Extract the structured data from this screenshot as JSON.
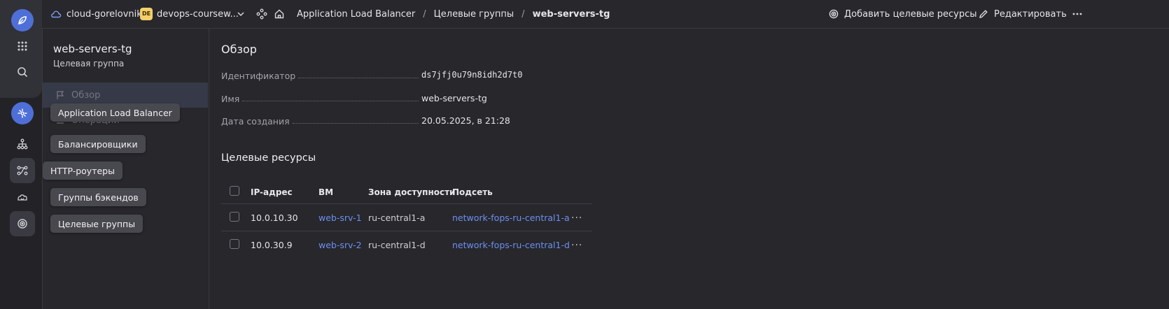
{
  "colors": {
    "accent": "#4f6fd8",
    "link": "#6e8ff0",
    "folder_badge": "#f4cf6a",
    "background": "#27272c"
  },
  "rail": {
    "icons": [
      "logo-icon",
      "apps-grid-icon",
      "search-icon",
      "alb-service-icon",
      "balancers-icon",
      "http-routers-icon",
      "backend-groups-icon",
      "target-groups-icon"
    ]
  },
  "topbar": {
    "cloud": "cloud-gorelovniko",
    "folder_badge": "DE",
    "folder": "devops-coursew...",
    "breadcrumbs": [
      "Application Load Balancer",
      "Целевые группы",
      "web-servers-tg"
    ],
    "add_resources": "Добавить целевые ресурсы",
    "edit": "Редактировать"
  },
  "sidebar": {
    "title": "web-servers-tg",
    "subtitle": "Целевая группа",
    "items": [
      {
        "label": "Обзор"
      },
      {
        "label": "Операции"
      }
    ]
  },
  "tooltips": [
    "Application Load Balancer",
    "Балансировщики",
    "HTTP-роутеры",
    "Группы бэкендов",
    "Целевые группы"
  ],
  "overview": {
    "title": "Обзор",
    "props": [
      {
        "label": "Идентификатор",
        "value": "ds7jfj0u79n8idh2d7t0"
      },
      {
        "label": "Имя",
        "value": "web-servers-tg"
      },
      {
        "label": "Дата создания",
        "value": "20.05.2025, в 21:28"
      }
    ]
  },
  "targets": {
    "title": "Целевые ресурсы",
    "columns": [
      "IP-адрес",
      "ВМ",
      "Зона доступности",
      "Подсеть"
    ],
    "rows": [
      {
        "ip": "10.0.10.30",
        "vm": "web-srv-1",
        "zone": "ru-central1-a",
        "subnet": "network-fops-ru-central1-a"
      },
      {
        "ip": "10.0.30.9",
        "vm": "web-srv-2",
        "zone": "ru-central1-d",
        "subnet": "network-fops-ru-central1-d"
      }
    ]
  }
}
